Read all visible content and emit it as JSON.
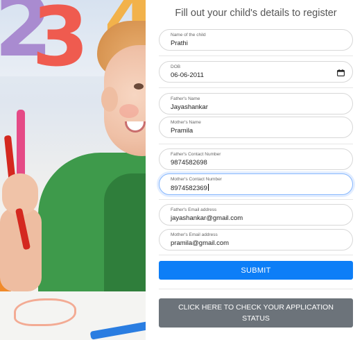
{
  "form": {
    "title": "Fill out your child's details to register",
    "fields": [
      {
        "label": "Name of the child",
        "value": "Prathi"
      },
      {
        "label": "DOB",
        "value": "06-06-2011",
        "icon": "calendar-icon"
      },
      {
        "label": "Father's Name",
        "value": "Jayashankar"
      },
      {
        "label": "Mother's Name",
        "value": "Pramila"
      },
      {
        "label": "Father's Contact Number",
        "value": "9874582698"
      },
      {
        "label": "Mother's Contact Number",
        "value": "8974582369"
      },
      {
        "label": "Father's Email address",
        "value": "jayashankar@gmail.com"
      },
      {
        "label": "Mother's Email address",
        "value": "pramila@gmail.com"
      }
    ],
    "submit_label": "SUBMIT",
    "status_label": "CLICK HERE TO CHECK YOUR APPLICATION STATUS"
  },
  "colors": {
    "primary": "#0d7ef7",
    "secondary": "#6c737a",
    "focus_border": "#86b7fe"
  }
}
